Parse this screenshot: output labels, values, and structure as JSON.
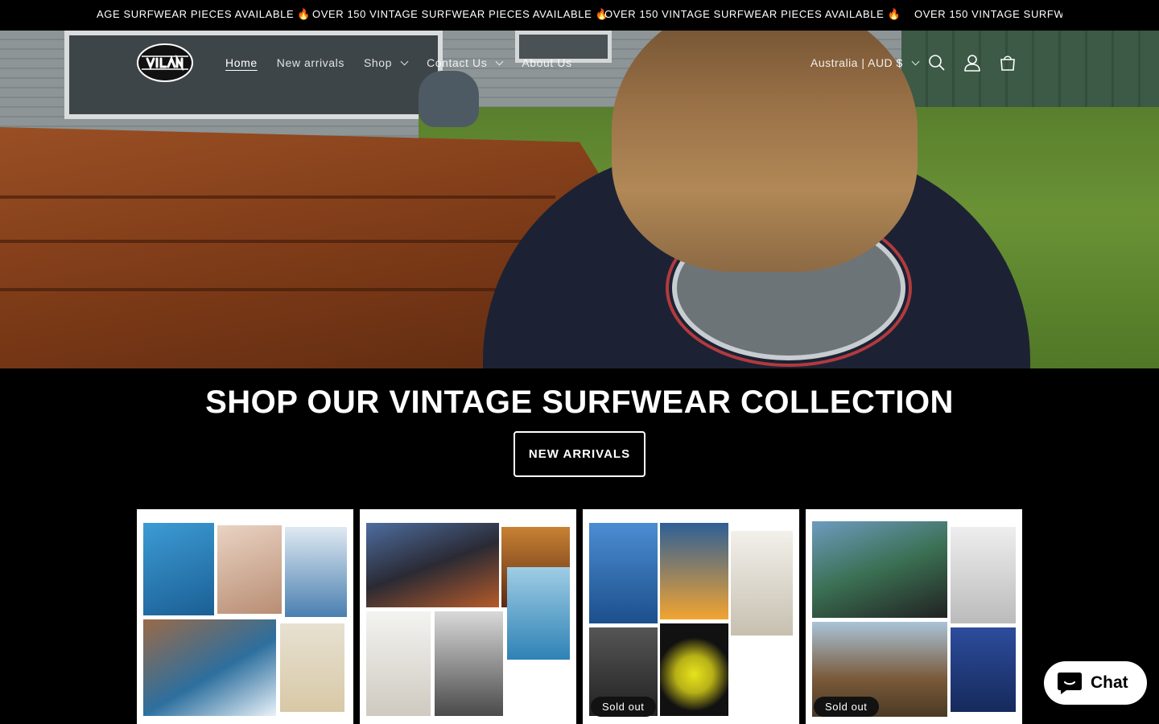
{
  "announcement": {
    "items": [
      "AGE SURFWEAR PIECES AVAILABLE 🔥",
      "OVER 150 VINTAGE SURFWEAR PIECES AVAILABLE 🔥",
      "OVER 150 VINTAGE SURFWEAR PIECES AVAILABLE 🔥",
      "OVER 150 VINTAGE SURFWEAR"
    ]
  },
  "header": {
    "logo_alt": "VIJLANTE",
    "nav": [
      {
        "label": "Home",
        "active": true
      },
      {
        "label": "New arrivals"
      },
      {
        "label": "Shop",
        "dropdown": true
      },
      {
        "label": "Contact Us",
        "dropdown": true
      },
      {
        "label": "About Us"
      }
    ],
    "locale": "Australia | AUD $",
    "icons": [
      "search-icon",
      "account-icon",
      "cart-icon"
    ]
  },
  "collection": {
    "heading": "SHOP OUR VINTAGE SURFWEAR COLLECTION",
    "button": "NEW ARRIVALS"
  },
  "products": [
    {
      "badge": ""
    },
    {
      "badge": ""
    },
    {
      "badge": "Sold out"
    },
    {
      "badge": "Sold out"
    }
  ],
  "chat": {
    "label": "Chat"
  },
  "colors": {
    "background": "#000000",
    "text": "#ffffff",
    "badge": "#121212"
  }
}
